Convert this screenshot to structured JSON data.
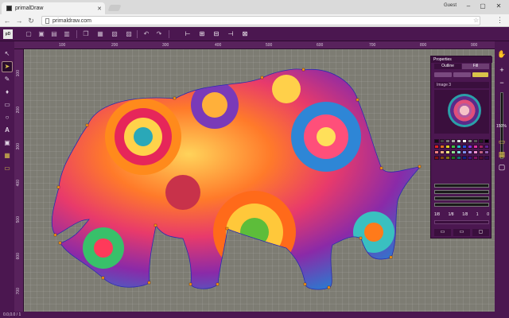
{
  "browser": {
    "tab_title": "primalDraw",
    "url": "primaldraw.com",
    "user": "Guest",
    "icons": [
      "close-icon",
      "minimize-icon",
      "maximize-icon",
      "back-icon",
      "forward-icon",
      "reload-icon",
      "star-icon",
      "menu-icon"
    ]
  },
  "app": {
    "logo_text": "pD",
    "toolbar_icons": [
      "new-icon",
      "open-icon",
      "save-icon",
      "copy-icon",
      "paste-icon",
      "delete-icon",
      "undo-icon",
      "redo-icon",
      "align-left-icon",
      "align-center-icon",
      "align-middle-icon",
      "align-right-icon",
      "distribute-icon"
    ],
    "left_tools": [
      "select-icon",
      "direct-select-icon",
      "pen-icon",
      "fill-icon",
      "rectangle-icon",
      "ellipse-icon",
      "text-icon",
      "image-icon",
      "grid-icon",
      "frame-icon"
    ],
    "right_tools": [
      "hand-icon",
      "zoom-in-icon",
      "zoom-out-icon"
    ],
    "zoom": "150%",
    "ruler_top": [
      "100",
      "200",
      "300",
      "400",
      "500",
      "600",
      "700",
      "800",
      "900"
    ],
    "ruler_left": [
      "100",
      "200",
      "300",
      "400",
      "500",
      "600",
      "700"
    ]
  },
  "properties": {
    "title": "Properties",
    "tabs": [
      "Outline",
      "Fill"
    ],
    "image_label": "Image 3",
    "dims": [
      "1/8",
      "1/8",
      "1/8",
      "1",
      "0"
    ],
    "colors": {
      "accent": "#4b1750",
      "canvas": "#7d7c73"
    }
  },
  "status": {
    "text": "0.0,0.0 / 1"
  }
}
